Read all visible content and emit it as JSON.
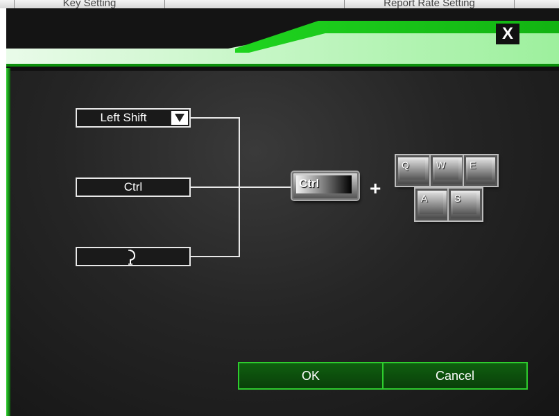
{
  "background_window": {
    "tab_left_label": "Key Setting",
    "tab_right_label": "Report Rate Setting"
  },
  "dialog": {
    "close_label": "X",
    "modifier_slots": [
      {
        "label": "Left Shift",
        "has_dropdown": true
      },
      {
        "label": "Ctrl"
      },
      {
        "label": ""
      }
    ],
    "result_key_label": "Ctrl",
    "plus_sign": "+",
    "keycaps": [
      "Q",
      "W",
      "E",
      "A",
      "S"
    ],
    "buttons": {
      "ok_label": "OK",
      "cancel_label": "Cancel"
    }
  },
  "colors": {
    "accent_green": "#2ecc2e",
    "button_fill": "#0c4d0c",
    "panel_dark": "#1a1a1a",
    "line_white": "#e8e8e8"
  }
}
